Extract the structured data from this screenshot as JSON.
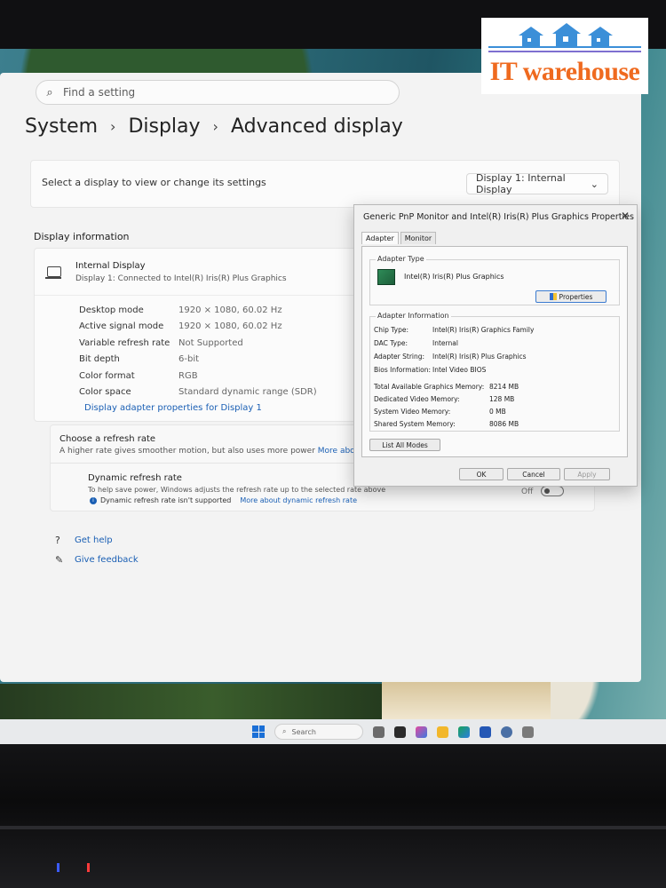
{
  "logo": {
    "text": "IT warehouse"
  },
  "search": {
    "placeholder": "Find a setting"
  },
  "breadcrumb": {
    "items": [
      "System",
      "Display",
      "Advanced display"
    ]
  },
  "display_select": {
    "prompt": "Select a display to view or change its settings",
    "value": "Display 1: Internal Display"
  },
  "display_info": {
    "section_title": "Display information",
    "name": "Internal Display",
    "subtitle": "Display 1: Connected to Intel(R) Iris(R) Plus Graphics",
    "rows": [
      {
        "label": "Desktop mode",
        "value": "1920 × 1080, 60.02 Hz"
      },
      {
        "label": "Active signal mode",
        "value": "1920 × 1080, 60.02 Hz"
      },
      {
        "label": "Variable refresh rate",
        "value": "Not Supported"
      },
      {
        "label": "Bit depth",
        "value": "6-bit"
      },
      {
        "label": "Color format",
        "value": "RGB"
      },
      {
        "label": "Color space",
        "value": "Standard dynamic range (SDR)"
      }
    ],
    "adapter_link": "Display adapter properties for Display 1"
  },
  "refresh": {
    "title": "Choose a refresh rate",
    "desc": "A higher rate gives smoother motion, but also uses more power",
    "desc_link": "More about refres",
    "dynamic_title": "Dynamic refresh rate",
    "dynamic_desc": "To help save power, Windows adjusts the refresh rate up to the selected rate above",
    "warning": "Dynamic refresh rate isn't supported",
    "warning_link": "More about dynamic refresh rate",
    "toggle_label": "Off"
  },
  "help": {
    "get_help": "Get help",
    "feedback": "Give feedback"
  },
  "dialog": {
    "title": "Generic PnP Monitor and Intel(R) Iris(R) Plus Graphics Properties",
    "tabs": [
      "Adapter",
      "Monitor"
    ],
    "adapter_type_label": "Adapter Type",
    "adapter_name": "Intel(R) Iris(R) Plus Graphics",
    "properties_btn": "Properties",
    "adapter_info_label": "Adapter Information",
    "info": [
      {
        "k": "Chip Type:",
        "v": "Intel(R) Iris(R) Graphics Family"
      },
      {
        "k": "DAC Type:",
        "v": "Internal"
      },
      {
        "k": "Adapter String:",
        "v": "Intel(R) Iris(R) Plus Graphics"
      },
      {
        "k": "Bios Information:",
        "v": "Intel Video BIOS"
      }
    ],
    "memory": [
      {
        "k": "Total Available Graphics Memory:",
        "v": "8214 MB"
      },
      {
        "k": "Dedicated Video Memory:",
        "v": "128 MB"
      },
      {
        "k": "System Video Memory:",
        "v": "0 MB"
      },
      {
        "k": "Shared System Memory:",
        "v": "8086 MB"
      }
    ],
    "list_modes_btn": "List All Modes",
    "ok_btn": "OK",
    "cancel_btn": "Cancel",
    "apply_btn": "Apply"
  },
  "taskbar": {
    "search": "Search"
  },
  "colors": {
    "accent": "#1a5fb4",
    "logo_orange": "#ef6a1f",
    "logo_blue": "#3b8fd8"
  }
}
